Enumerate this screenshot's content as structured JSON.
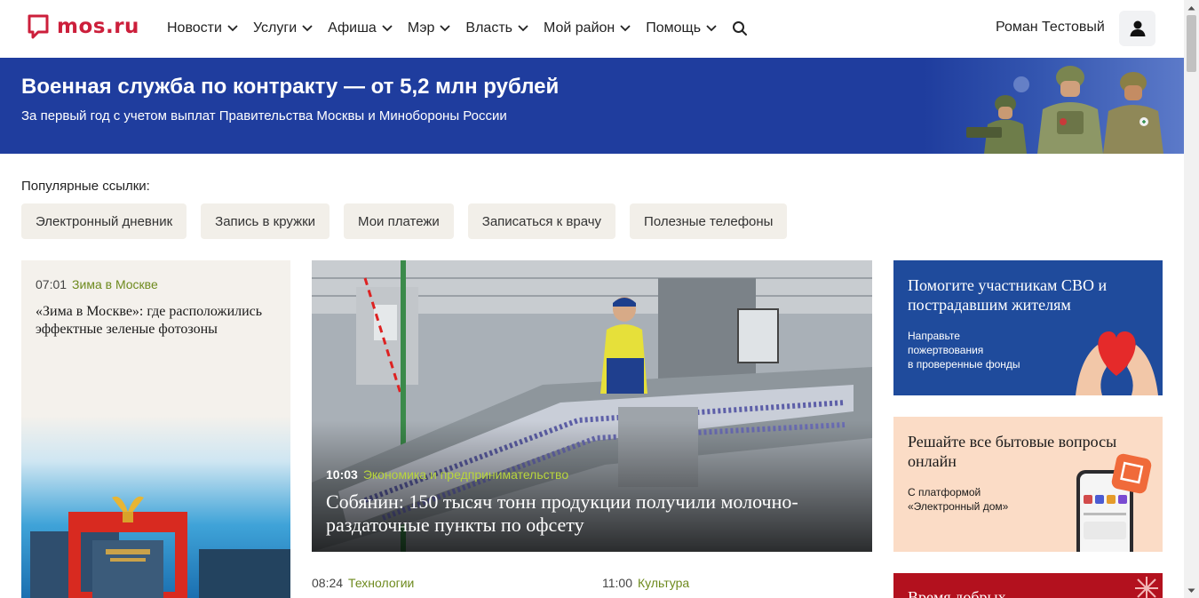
{
  "header": {
    "logo_text": "mos.ru",
    "nav": [
      {
        "label": "Новости"
      },
      {
        "label": "Услуги"
      },
      {
        "label": "Афиша"
      },
      {
        "label": "Мэр"
      },
      {
        "label": "Власть"
      },
      {
        "label": "Мой район"
      },
      {
        "label": "Помощь"
      }
    ],
    "user_name": "Роман Тестовый"
  },
  "banner": {
    "title": "Военная служба по контракту — от 5,2 млн рублей",
    "subtitle": "За первый год с учетом выплат Правительства Москвы и Минобороны России"
  },
  "popular": {
    "label": "Популярные ссылки:",
    "links": [
      "Электронный дневник",
      "Запись в кружки",
      "Мои платежи",
      "Записаться к врачу",
      "Полезные телефоны"
    ]
  },
  "left_card": {
    "time": "07:01",
    "category": "Зима в Москве",
    "title": "«Зима в Москве»: где расположились эффектные зеленые фотозоны"
  },
  "main_news": {
    "time": "10:03",
    "category": "Экономика и предпринимательство",
    "title": "Собянин: 150 тысяч тонн продукции получили молочно-раздаточные пункты по офсету"
  },
  "sub_news": [
    {
      "time": "08:24",
      "category": "Технологии"
    },
    {
      "time": "11:00",
      "category": "Культура"
    }
  ],
  "promos": [
    {
      "title": "Помогите участникам СВО и пострадавшим жителям",
      "text": [
        "Направьте",
        "пожертвования",
        "в проверенные фонды"
      ]
    },
    {
      "title": "Решайте все бытовые вопросы онлайн",
      "text": [
        "С платформой",
        "«Электронный дом»"
      ]
    },
    {
      "title": "Время добрых"
    }
  ],
  "colors": {
    "brand": "#cc1f3b",
    "banner_bg": "#1f3d9e",
    "category_green": "#6e8a1e",
    "category_lime": "#b9d63c"
  }
}
